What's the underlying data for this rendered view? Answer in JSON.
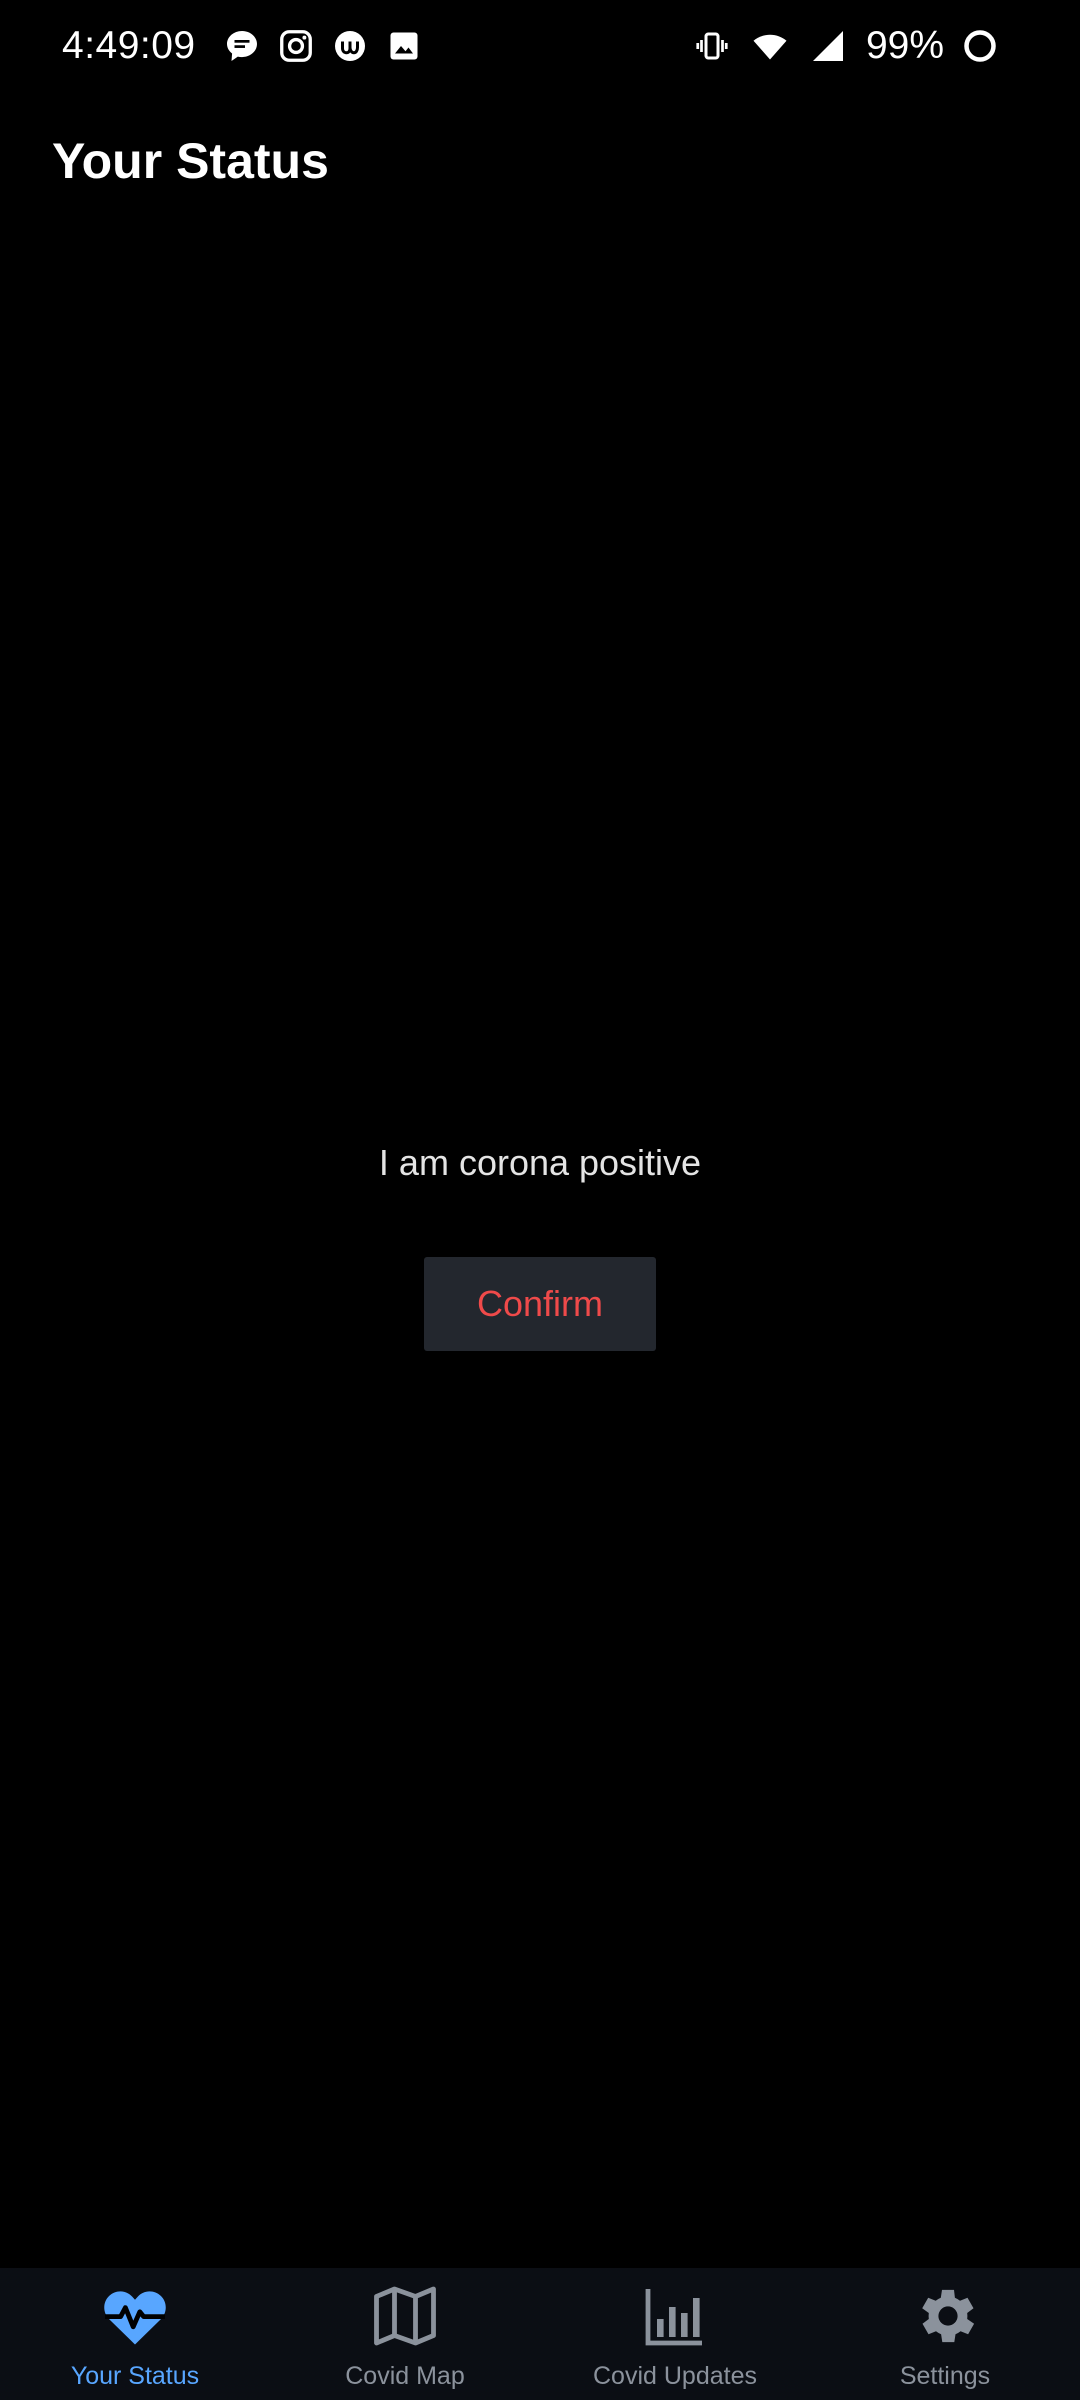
{
  "status_bar": {
    "time": "4:49:09",
    "battery": "99%",
    "left_icons": [
      "chat-bubble-icon",
      "instagram-icon",
      "app-u-icon",
      "image-icon"
    ],
    "right_icons": [
      "vibrate-icon",
      "wifi-icon",
      "signal-icon",
      "battery-ring-icon"
    ]
  },
  "header": {
    "title": "Your Status"
  },
  "main": {
    "status_text": "I am corona positive",
    "confirm_label": "Confirm"
  },
  "bottom_nav": {
    "items": [
      {
        "label": "Your Status",
        "icon": "heart-pulse-icon",
        "active": true
      },
      {
        "label": "Covid Map",
        "icon": "map-icon",
        "active": false
      },
      {
        "label": "Covid Updates",
        "icon": "bar-chart-icon",
        "active": false
      },
      {
        "label": "Settings",
        "icon": "gear-icon",
        "active": false
      }
    ]
  },
  "colors": {
    "background": "#000000",
    "accent": "#58a6ff",
    "danger": "#ef4a4a",
    "nav_background": "#0b0e14",
    "button_background": "#23272e"
  }
}
